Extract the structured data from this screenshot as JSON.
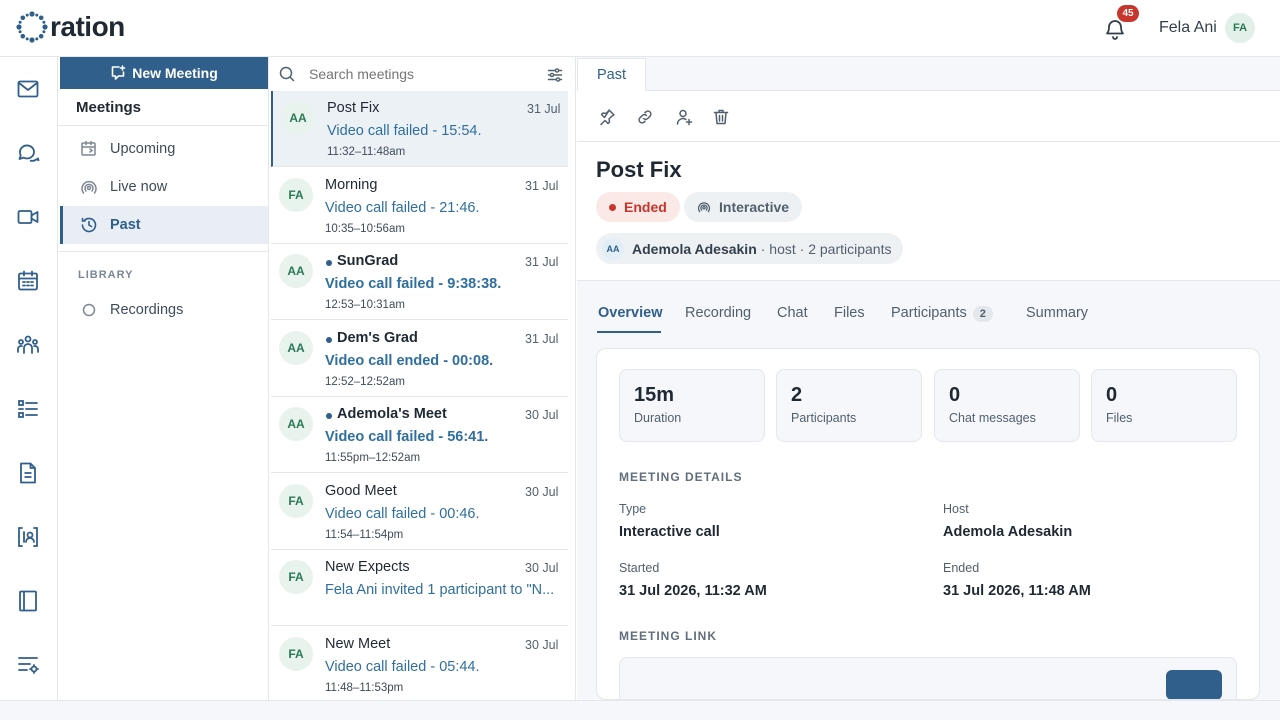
{
  "app": {
    "logo_text": "ration"
  },
  "header": {
    "notification_count": "45",
    "user_name": "Fela Ani",
    "user_initials": "FA"
  },
  "rail": {
    "icons": [
      "mail-icon",
      "chat-icon",
      "video-icon",
      "calendar-icon",
      "people-icon",
      "list-icon",
      "document-icon",
      "contact-card-icon",
      "book-icon",
      "settings-list-icon"
    ]
  },
  "nav": {
    "new_meeting_label": "New Meeting",
    "heading": "Meetings",
    "items": [
      {
        "label": "Upcoming"
      },
      {
        "label": "Live now"
      },
      {
        "label": "Past"
      }
    ],
    "library_heading": "LIBRARY",
    "library_items": [
      {
        "label": "Recordings"
      }
    ]
  },
  "search": {
    "placeholder": "Search meetings"
  },
  "meetings": [
    {
      "initials": "AA",
      "title": "Post Fix",
      "date": "31 Jul",
      "status": "Video call failed - 15:54.",
      "time": "11:32–11:48am",
      "unread": false,
      "selected": true
    },
    {
      "initials": "FA",
      "title": "Morning",
      "date": "31 Jul",
      "status": "Video call failed - 21:46.",
      "time": "10:35–10:56am",
      "unread": false,
      "selected": false
    },
    {
      "initials": "AA",
      "title": "SunGrad",
      "date": "31 Jul",
      "status": "Video call failed - 9:38:38.",
      "time": "12:53–10:31am",
      "unread": true,
      "selected": false
    },
    {
      "initials": "AA",
      "title": "Dem's Grad",
      "date": "31 Jul",
      "status": "Video call ended - 00:08.",
      "time": "12:52–12:52am",
      "unread": true,
      "selected": false
    },
    {
      "initials": "AA",
      "title": "Ademola's Meet",
      "date": "30 Jul",
      "status": "Video call failed - 56:41.",
      "time": "11:55pm–12:52am",
      "unread": true,
      "selected": false
    },
    {
      "initials": "FA",
      "title": "Good Meet",
      "date": "30 Jul",
      "status": "Video call failed - 00:46.",
      "time": "11:54–11:54pm",
      "unread": false,
      "selected": false
    },
    {
      "initials": "FA",
      "title": "New Expects",
      "date": "30 Jul",
      "status": "Fela Ani invited 1 participant to \"N...",
      "time": "",
      "unread": false,
      "selected": false
    },
    {
      "initials": "FA",
      "title": "New Meet",
      "date": "30 Jul",
      "status": "Video call failed - 05:44.",
      "time": "11:48–11:53pm",
      "unread": false,
      "selected": false
    }
  ],
  "detail": {
    "tab_label": "Past",
    "title": "Post Fix",
    "status_pill": "Ended",
    "type_pill": "Interactive",
    "host_initials": "AA",
    "host_name": "Ademola Adesakin",
    "host_meta": "· host · 2 participants",
    "subtabs": [
      {
        "label": "Overview"
      },
      {
        "label": "Recording"
      },
      {
        "label": "Chat"
      },
      {
        "label": "Files"
      },
      {
        "label": "Participants",
        "count": "2"
      },
      {
        "label": "Summary"
      }
    ],
    "stats": [
      {
        "value": "15m",
        "label": "Duration"
      },
      {
        "value": "2",
        "label": "Participants"
      },
      {
        "value": "0",
        "label": "Chat messages"
      },
      {
        "value": "0",
        "label": "Files"
      }
    ],
    "details_heading": "MEETING DETAILS",
    "fields": {
      "type_label": "Type",
      "type_value": "Interactive call",
      "host_label": "Host",
      "host_value": "Ademola Adesakin",
      "started_label": "Started",
      "started_value": "31 Jul 2026, 11:32 AM",
      "ended_label": "Ended",
      "ended_value": "31 Jul 2026, 11:48 AM"
    },
    "link_heading": "MEETING LINK"
  },
  "colors": {
    "accent": "#2f5f8a",
    "danger": "#c7352b",
    "link": "#2f6f9f"
  }
}
